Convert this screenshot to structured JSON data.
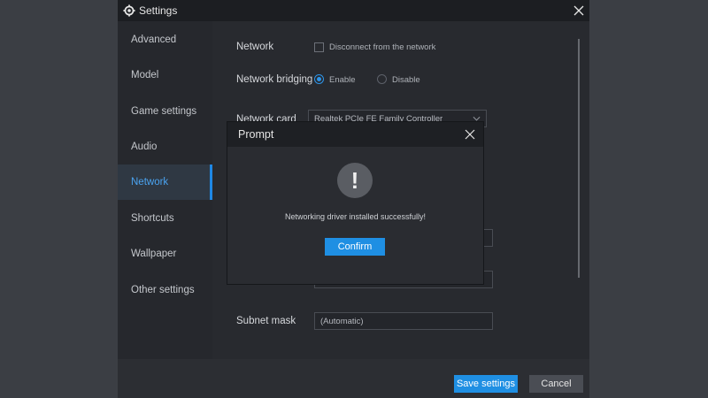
{
  "window": {
    "title": "Settings"
  },
  "sidebar": {
    "items": [
      {
        "label": "Advanced"
      },
      {
        "label": "Model"
      },
      {
        "label": "Game settings"
      },
      {
        "label": "Audio"
      },
      {
        "label": "Network"
      },
      {
        "label": "Shortcuts"
      },
      {
        "label": "Wallpaper"
      },
      {
        "label": "Other settings"
      }
    ],
    "active_index": 4
  },
  "network": {
    "network_label": "Network",
    "disconnect_label": "Disconnect from the network",
    "bridging_label": "Network bridging",
    "enable_label": "Enable",
    "disable_label": "Disable",
    "card_label": "Network card",
    "card_value": "Realtek PCIe FE Family Controller",
    "subnet_label": "Subnet mask",
    "subnet_value": "(Automatic)"
  },
  "footer": {
    "save_label": "Save settings",
    "cancel_label": "Cancel"
  },
  "prompt": {
    "title": "Prompt",
    "message": "Networking driver installed successfully!",
    "confirm_label": "Confirm",
    "icon_glyph": "!"
  },
  "colors": {
    "accent": "#1f8fe3",
    "background": "#282a2f",
    "sidebar": "#26282d",
    "titlebar": "#1c1e22"
  }
}
